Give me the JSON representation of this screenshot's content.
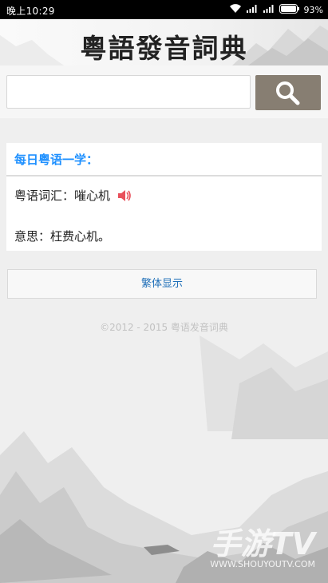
{
  "status_bar": {
    "time": "晚上10:29",
    "battery_percent": "93%",
    "icons": [
      "wifi-icon",
      "signal-icon",
      "signal-icon",
      "battery-icon"
    ]
  },
  "header": {
    "title": "粵語發音詞典"
  },
  "search": {
    "input_value": "",
    "placeholder": "",
    "button_icon": "search-icon"
  },
  "daily": {
    "title": "每日粤语一学：",
    "word_label": "粤语词汇：",
    "word_value": "嗺心机",
    "meaning_label": "意思：",
    "meaning_value": "枉费心机。",
    "speaker_icon": "speaker-icon"
  },
  "toggle_button": {
    "label": "繁体显示"
  },
  "footer": {
    "copyright": "©2012 - 2015 粤语发音词典"
  },
  "watermark": {
    "brand": "手游TV",
    "url": "WWW.SHOUYOUTV.COM"
  },
  "colors": {
    "accent_blue": "#1e90ff",
    "search_button": "#877e72",
    "speaker": "#e8505b"
  }
}
